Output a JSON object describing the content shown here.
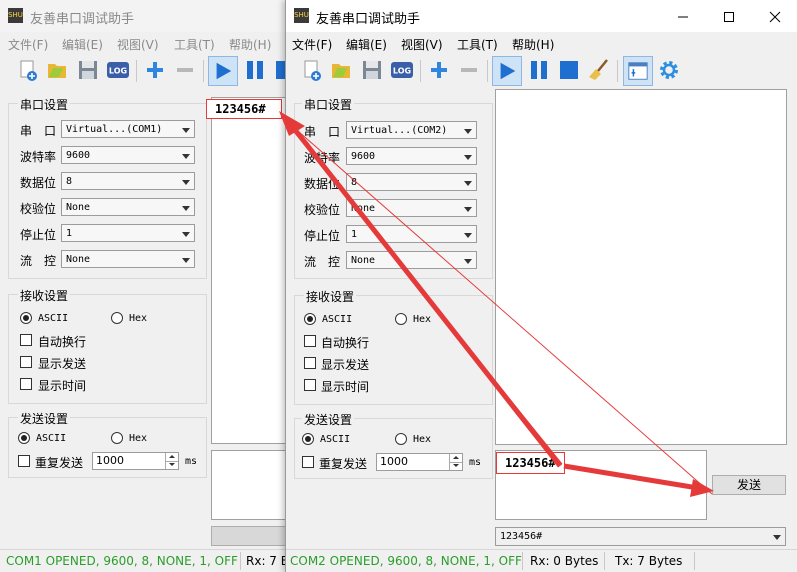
{
  "colors": {
    "status_green": "#2a9d2a",
    "arrow_red": "#e53a3a",
    "play_blue": "#1f6fd1"
  },
  "icons": [
    "new-icon",
    "open-icon",
    "save-icon",
    "log-icon",
    "plus-icon",
    "minus-icon",
    "play-icon",
    "pause-icon",
    "stop-icon",
    "broom-icon",
    "window-icon",
    "gear-icon"
  ],
  "window1": {
    "title": "友善串口调试助手",
    "menu": [
      "文件(F)",
      "编辑(E)",
      "视图(V)",
      "工具(T)",
      "帮助(H)"
    ],
    "serial_group": "串口设置",
    "labels": {
      "port": "串　口",
      "baud": "波特率",
      "databits": "数据位",
      "parity": "校验位",
      "stopbits": "停止位",
      "flow": "流　控"
    },
    "values": {
      "port": "Virtual...(COM1)",
      "baud": "9600",
      "databits": "8",
      "parity": "None",
      "stopbits": "1",
      "flow": "None"
    },
    "receive_group": "接收设置",
    "recv_ascii": "ASCII",
    "recv_hex": "Hex",
    "auto_newline": "自动换行",
    "show_send": "显示发送",
    "show_time": "显示时间",
    "send_group": "发送设置",
    "send_ascii": "ASCII",
    "send_hex": "Hex",
    "repeat_send": "重复发送",
    "repeat_interval": "1000",
    "ms": "ms",
    "received_text": "123456#",
    "status_open": "COM1 OPENED, 9600, 8, NONE, 1, OFF",
    "status_rx": "Rx: 7 B"
  },
  "window2": {
    "title": "友善串口调试助手",
    "menu": [
      "文件(F)",
      "编辑(E)",
      "视图(V)",
      "工具(T)",
      "帮助(H)"
    ],
    "serial_group": "串口设置",
    "labels": {
      "port": "串　口",
      "baud": "波特率",
      "databits": "数据位",
      "parity": "校验位",
      "stopbits": "停止位",
      "flow": "流　控"
    },
    "values": {
      "port": "Virtual...(COM2)",
      "baud": "9600",
      "databits": "8",
      "parity": "None",
      "stopbits": "1",
      "flow": "None"
    },
    "receive_group": "接收设置",
    "recv_ascii": "ASCII",
    "recv_hex": "Hex",
    "auto_newline": "自动换行",
    "show_send": "显示发送",
    "show_time": "显示时间",
    "send_group": "发送设置",
    "send_ascii": "ASCII",
    "send_hex": "Hex",
    "repeat_send": "重复发送",
    "repeat_interval": "1000",
    "ms": "ms",
    "send_text": "123456#",
    "send_button": "发送",
    "history_value": "123456#",
    "status_open": "COM2 OPENED, 9600, 8, NONE, 1, OFF",
    "status_rx": "Rx: 0 Bytes",
    "status_tx": "Tx: 7 Bytes"
  }
}
